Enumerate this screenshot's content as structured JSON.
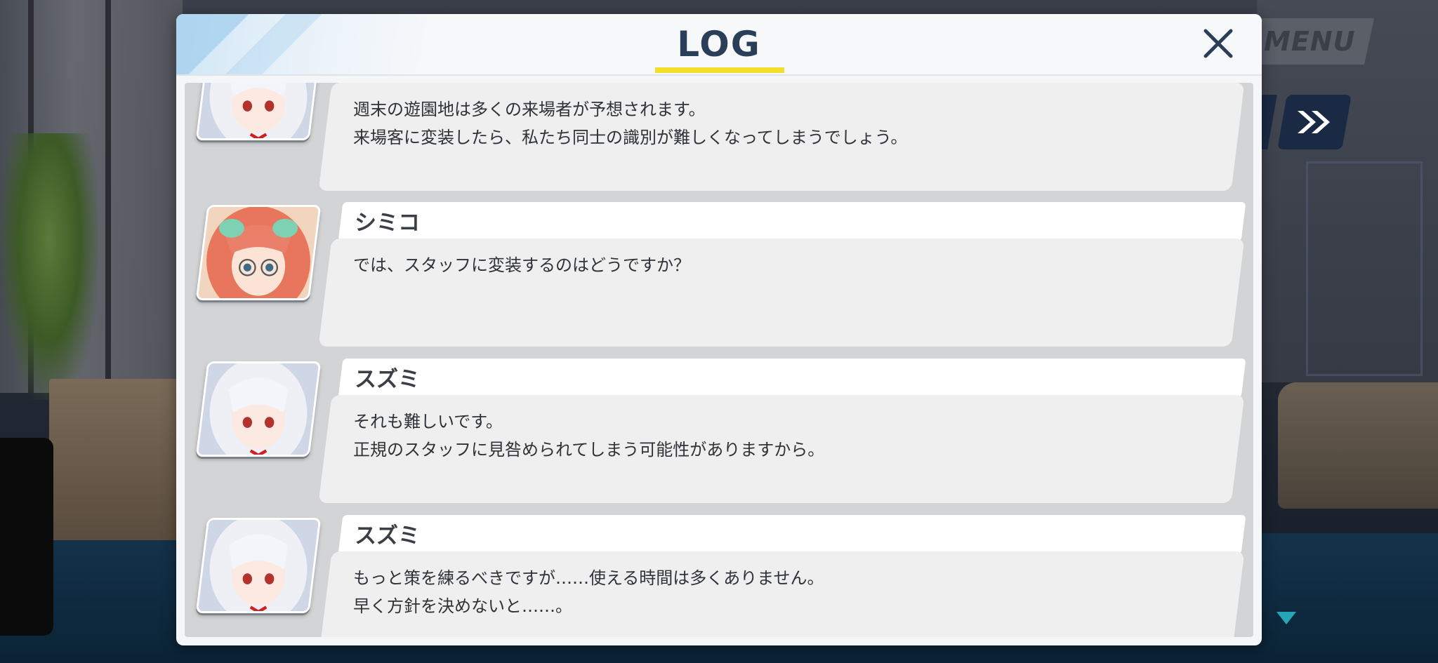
{
  "header": {
    "title": "LOG",
    "close_icon": "close-icon"
  },
  "hud": {
    "menu_label": "MENU",
    "skip_icon": "double-chevron-right-icon",
    "scroll_icon": "triangle-down-icon"
  },
  "colors": {
    "title": "#2b3e58",
    "underline": "#f3de2c",
    "accent_teal": "#27a6b8",
    "skip_button": "#1b2a44"
  },
  "log": {
    "entries": [
      {
        "speaker": "",
        "avatar": "suzumi-portrait",
        "lines": [
          "週末の遊園地は多くの来場者が予想されます。",
          "来場客に変装したら、私たち同士の識別が難しくなってしまうでしょう。"
        ]
      },
      {
        "speaker": "シミコ",
        "avatar": "shimiko-portrait",
        "lines": [
          "では、スタッフに変装するのはどうですか？"
        ]
      },
      {
        "speaker": "スズミ",
        "avatar": "suzumi-portrait",
        "lines": [
          "それも難しいです。",
          "正規のスタッフに見咎められてしまう可能性がありますから。"
        ]
      },
      {
        "speaker": "スズミ",
        "avatar": "suzumi-portrait",
        "lines": [
          "もっと策を練るべきですが……使える時間は多くありません。",
          "早く方針を決めないと……。"
        ]
      }
    ]
  }
}
